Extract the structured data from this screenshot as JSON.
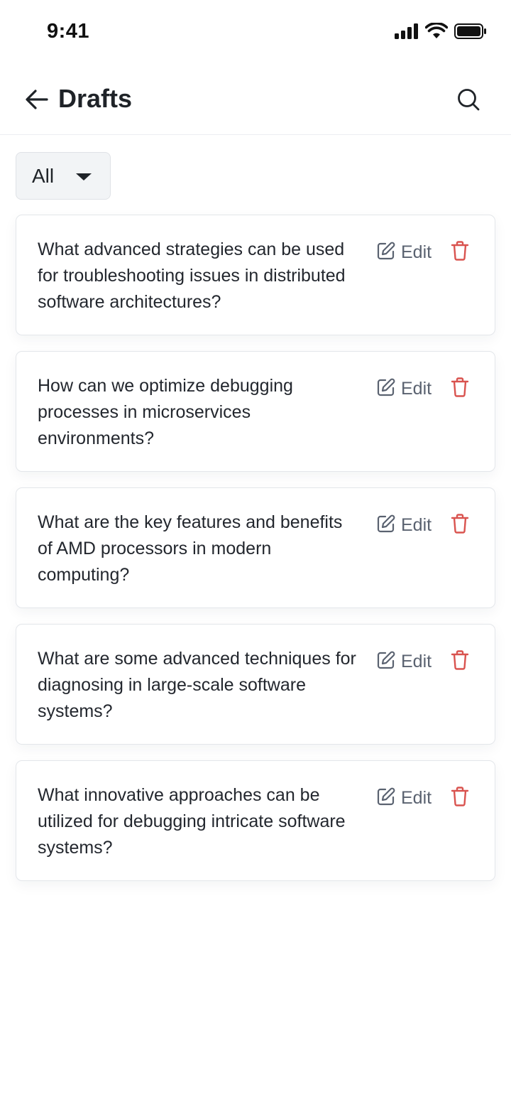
{
  "status_bar": {
    "time": "9:41",
    "icons": [
      "cellular-signal-icon",
      "wifi-icon",
      "battery-icon"
    ]
  },
  "header": {
    "title": "Drafts",
    "back_icon": "arrow-left-icon",
    "search_icon": "search-icon"
  },
  "filter": {
    "selected": "All"
  },
  "drafts": [
    {
      "text": "What advanced strategies can be used for troubleshooting issues in distributed software architectures?",
      "edit_label": "Edit"
    },
    {
      "text": "How can we optimize debugging processes in microservices environments?",
      "edit_label": "Edit"
    },
    {
      "text": "What are the key features and benefits of AMD processors in modern computing?",
      "edit_label": "Edit"
    },
    {
      "text": "What are some advanced techniques for diagnosing in large-scale software systems?",
      "edit_label": "Edit"
    },
    {
      "text": "What innovative approaches can be utilized for debugging intricate software systems?",
      "edit_label": "Edit"
    }
  ],
  "colors": {
    "delete": "#d9534f",
    "edit": "#5a6270",
    "text": "#23272e"
  }
}
